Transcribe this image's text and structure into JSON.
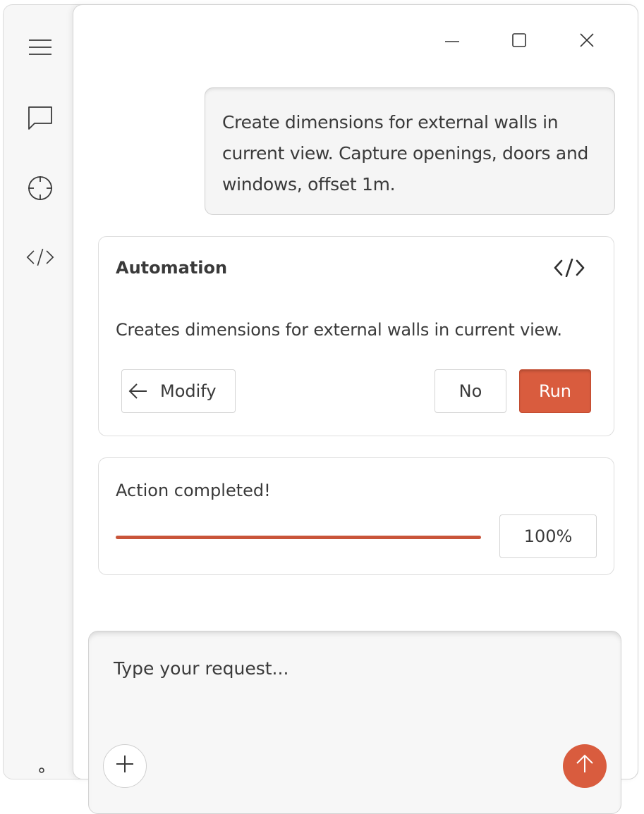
{
  "sidebar": {
    "items": [
      {
        "icon": "menu-icon"
      },
      {
        "icon": "chat-icon"
      },
      {
        "icon": "target-icon"
      },
      {
        "icon": "code-icon"
      }
    ]
  },
  "window_controls": [
    "minimize-icon",
    "maximize-icon",
    "close-icon"
  ],
  "conversation": {
    "user_message": "Create dimensions for external walls in current view. Capture openings, doors and windows, offset 1m."
  },
  "automation_card": {
    "title": "Automation",
    "description": "Creates dimensions for external walls in current view.",
    "modify_label": "Modify",
    "no_label": "No",
    "run_label": "Run"
  },
  "progress_card": {
    "status": "Action completed!",
    "percent_label": "100%",
    "progress": 1.0
  },
  "composer": {
    "placeholder": "Type your request..."
  },
  "colors": {
    "accent": "#d95c3e",
    "progress": "#c9553a"
  }
}
